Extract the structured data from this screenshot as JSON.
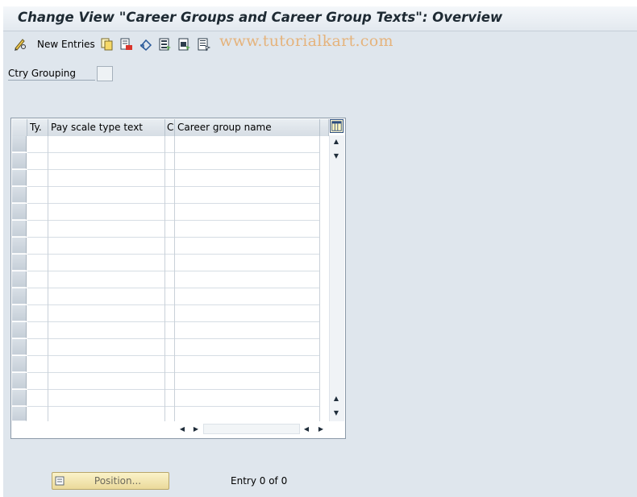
{
  "window": {
    "title": "Change View \"Career Groups and Career Group Texts\": Overview"
  },
  "toolbar": {
    "new_entries_label": "New Entries",
    "icons": [
      "edit-glasses-icon",
      "copy-icon",
      "delete-icon",
      "undo-icon",
      "select-all-icon",
      "select-block-icon",
      "deselect-all-icon"
    ]
  },
  "watermark": "www.tutorialkart.com",
  "filter": {
    "ctry_grouping_label": "Ctry Grouping",
    "ctry_grouping_value": ""
  },
  "table": {
    "columns": [
      "Ty.",
      "Pay scale type text",
      "C",
      "Career group name"
    ],
    "visible_rows": 17,
    "rows": []
  },
  "footer": {
    "position_button_label": "Position...",
    "entry_info": "Entry 0 of 0"
  },
  "colors": {
    "background": "#dfe6ed",
    "button_yellow": "#f5e7a8",
    "watermark": "#e5b37c"
  }
}
